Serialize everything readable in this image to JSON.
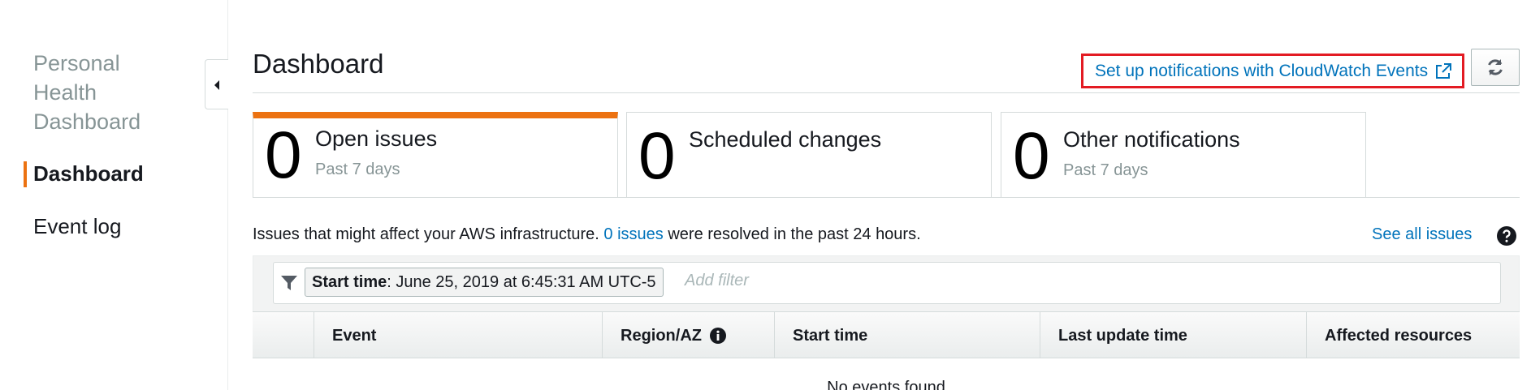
{
  "sidebar": {
    "title": "Personal Health Dashboard",
    "items": [
      {
        "label": "Dashboard",
        "active": true
      },
      {
        "label": "Event log",
        "active": false
      }
    ]
  },
  "header": {
    "title": "Dashboard",
    "notifications_link": "Set up notifications with CloudWatch Events",
    "refresh_icon": "refresh-icon",
    "external_icon": "external-link-icon"
  },
  "summary": [
    {
      "count": "0",
      "label": "Open issues",
      "sub": "Past 7 days",
      "active": true
    },
    {
      "count": "0",
      "label": "Scheduled changes",
      "sub": "",
      "active": false
    },
    {
      "count": "0",
      "label": "Other notifications",
      "sub": "Past 7 days",
      "active": false
    }
  ],
  "info": {
    "prefix": "Issues that might affect your AWS infrastructure.",
    "link": "0 issues",
    "suffix": "were resolved in the past 24 hours.",
    "see_all": "See all issues"
  },
  "filter": {
    "token_key": "Start time",
    "token_value": ": June 25, 2019 at 6:45:31 AM UTC-5",
    "placeholder": "Add filter"
  },
  "table": {
    "columns": [
      "Event",
      "Region/AZ",
      "Start time",
      "Last update time",
      "Affected resources"
    ],
    "empty_message": "No events found"
  },
  "colors": {
    "accent": "#ec7211",
    "link": "#0073bb",
    "highlight_box": "#e31b23"
  }
}
